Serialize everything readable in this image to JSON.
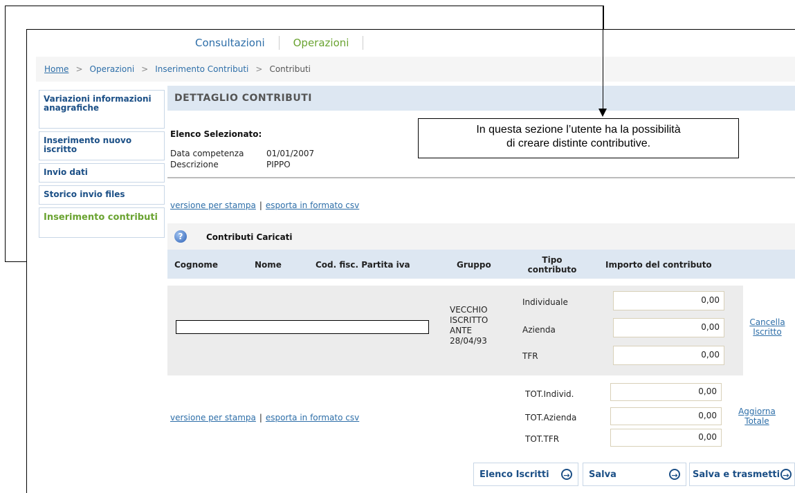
{
  "topnav": {
    "tabs": [
      "Consultazioni",
      "Operazioni"
    ]
  },
  "breadcrumb": {
    "home": "Home",
    "items": [
      "Operazioni",
      "Inserimento Contributi",
      "Contributi"
    ],
    "separator": ">"
  },
  "sidebar": {
    "items": [
      {
        "label": "Variazioni informazioni anagrafiche"
      },
      {
        "label": "Inserimento nuovo iscritto"
      },
      {
        "label": "Invio dati"
      },
      {
        "label": "Storico invio files"
      },
      {
        "label": "Inserimento contributi"
      }
    ]
  },
  "section": {
    "title": "DETTAGLIO CONTRIBUTI"
  },
  "elenco": {
    "title": "Elenco Selezionato:",
    "data_label": "Data competenza",
    "data_value": "01/01/2007",
    "desc_label": "Descrizione",
    "desc_value": "PIPPO"
  },
  "links": {
    "print": "versione per stampa",
    "pipe": "|",
    "csv": "esporta in formato csv"
  },
  "caricati": {
    "label": "Contributi Caricati"
  },
  "table": {
    "headers": [
      "Cognome",
      "Nome",
      "Cod. fisc. Partita iva",
      "Gruppo",
      "Tipo contributo",
      "Importo del contributo"
    ],
    "row": {
      "gruppo": "VECCHIO ISCRITTO ANTE 28/04/93",
      "contributi": [
        {
          "tipo": "Individuale",
          "importo": "0,00"
        },
        {
          "tipo": "Azienda",
          "importo": "0,00"
        },
        {
          "tipo": "TFR",
          "importo": "0,00"
        }
      ],
      "action": "Cancella Iscritto"
    }
  },
  "totals": {
    "items": [
      {
        "label": "TOT.Individ.",
        "value": "0,00"
      },
      {
        "label": "TOT.Azienda",
        "value": "0,00"
      },
      {
        "label": "TOT.TFR",
        "value": "0,00"
      }
    ],
    "action": "Aggiorna Totale"
  },
  "buttons": {
    "elenco": "Elenco Iscritti",
    "salva": "Salva",
    "trasmetti": "Salva e trasmetti"
  },
  "annotation": {
    "line1": "In questa sezione l’utente ha la possibilità",
    "line2": "di creare distinte contributive."
  }
}
